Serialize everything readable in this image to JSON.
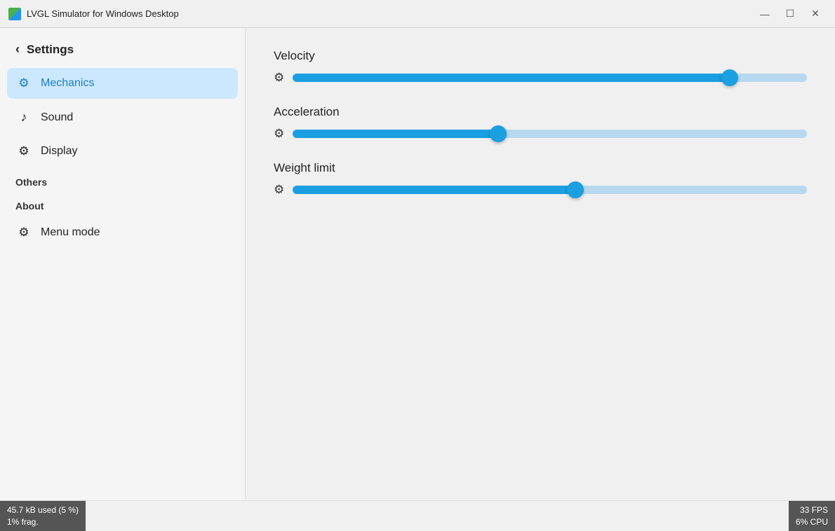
{
  "titlebar": {
    "title": "LVGL Simulator for Windows Desktop",
    "minimize_label": "—",
    "maximize_label": "☐",
    "close_label": "✕"
  },
  "sidebar": {
    "back_label": "Settings",
    "items": [
      {
        "id": "mechanics",
        "label": "Mechanics",
        "icon": "⚙",
        "active": true
      },
      {
        "id": "sound",
        "label": "Sound",
        "icon": "♩",
        "active": false
      },
      {
        "id": "display",
        "label": "Display",
        "icon": "⚙",
        "active": false
      }
    ],
    "section_others": "Others",
    "section_about": "About",
    "menu_mode_label": "Menu mode",
    "menu_mode_icon": "⚙"
  },
  "main": {
    "sliders": [
      {
        "label": "Velocity",
        "value": 85,
        "min": 0,
        "max": 100
      },
      {
        "label": "Acceleration",
        "value": 40,
        "min": 0,
        "max": 100
      },
      {
        "label": "Weight limit",
        "value": 55,
        "min": 0,
        "max": 100
      }
    ]
  },
  "statusbar": {
    "left_line1": "45.7 kB used (5 %)",
    "left_line2": "1% frag.",
    "right_line1": "33 FPS",
    "right_line2": "6% CPU"
  }
}
